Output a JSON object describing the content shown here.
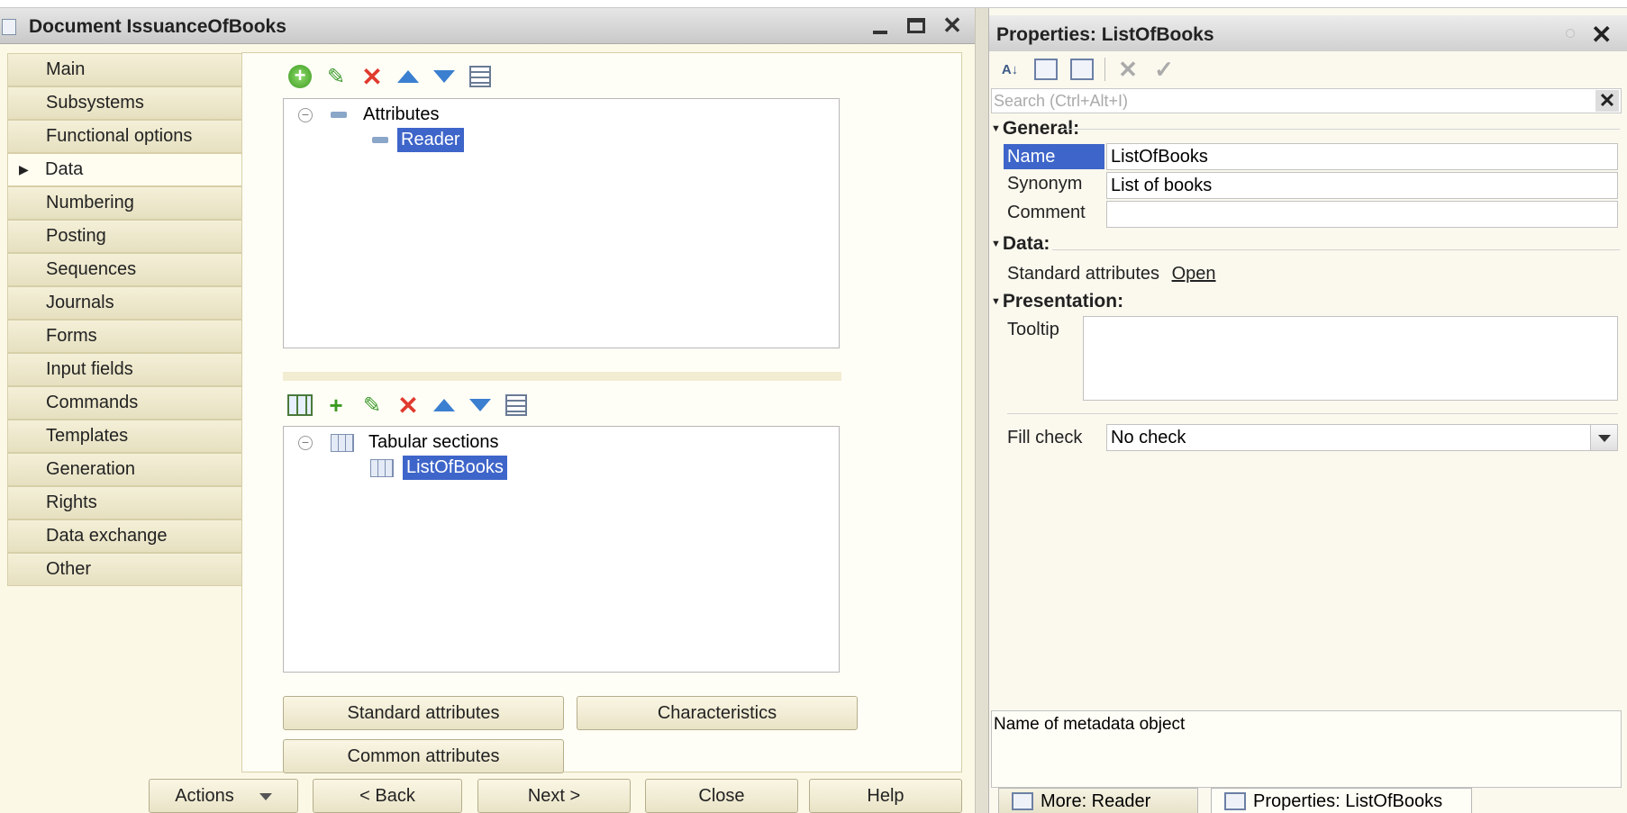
{
  "document": {
    "title": "Document IssuanceOfBooks",
    "nav": [
      {
        "label": "Main",
        "active": false
      },
      {
        "label": "Subsystems",
        "active": false
      },
      {
        "label": "Functional options",
        "active": false
      },
      {
        "label": "Data",
        "active": true
      },
      {
        "label": "Numbering",
        "active": false
      },
      {
        "label": "Posting",
        "active": false
      },
      {
        "label": "Sequences",
        "active": false
      },
      {
        "label": "Journals",
        "active": false
      },
      {
        "label": "Forms",
        "active": false
      },
      {
        "label": "Input fields",
        "active": false
      },
      {
        "label": "Commands",
        "active": false
      },
      {
        "label": "Templates",
        "active": false
      },
      {
        "label": "Generation",
        "active": false
      },
      {
        "label": "Rights",
        "active": false
      },
      {
        "label": "Data exchange",
        "active": false
      },
      {
        "label": "Other",
        "active": false
      }
    ],
    "attributes_tree": {
      "root": "Attributes",
      "items": [
        "Reader"
      ]
    },
    "tabular_tree": {
      "root": "Tabular sections",
      "items": [
        "ListOfBooks"
      ]
    },
    "buttons": {
      "standard_attributes": "Standard attributes",
      "characteristics": "Characteristics",
      "common_attributes": "Common attributes"
    },
    "footer": {
      "actions": "Actions",
      "back": "< Back",
      "next": "Next >",
      "close": "Close",
      "help": "Help"
    }
  },
  "properties": {
    "title": "Properties: ListOfBooks",
    "search_placeholder": "Search (Ctrl+Alt+I)",
    "sections": {
      "general": "General:",
      "data": "Data:",
      "presentation": "Presentation:"
    },
    "fields": {
      "name_label": "Name",
      "name_value": "ListOfBooks",
      "synonym_label": "Synonym",
      "synonym_value": "List of books",
      "comment_label": "Comment",
      "comment_value": "",
      "standard_attributes_label": "Standard attributes",
      "standard_attributes_link": "Open",
      "tooltip_label": "Tooltip",
      "fill_check_label": "Fill check",
      "fill_check_value": "No check"
    },
    "description": "Name of metadata object",
    "tabs": [
      {
        "label": "More: Reader",
        "active": false
      },
      {
        "label": "Properties: ListOfBooks",
        "active": true
      }
    ]
  },
  "icons": [
    "document-icon",
    "add-icon",
    "edit-icon",
    "delete-icon",
    "move-up-icon",
    "move-down-icon",
    "sort-icon",
    "add-table-icon",
    "add-column-icon",
    "sort-alpha-icon",
    "categories-icon",
    "filter-icon",
    "cancel-icon",
    "check-icon"
  ],
  "colors": {
    "selection": "#3e65c9",
    "panel_background": "#fbf8e6",
    "delete": "#e03a2e",
    "add": "#3c9a22",
    "arrows": "#3a7fd0"
  }
}
